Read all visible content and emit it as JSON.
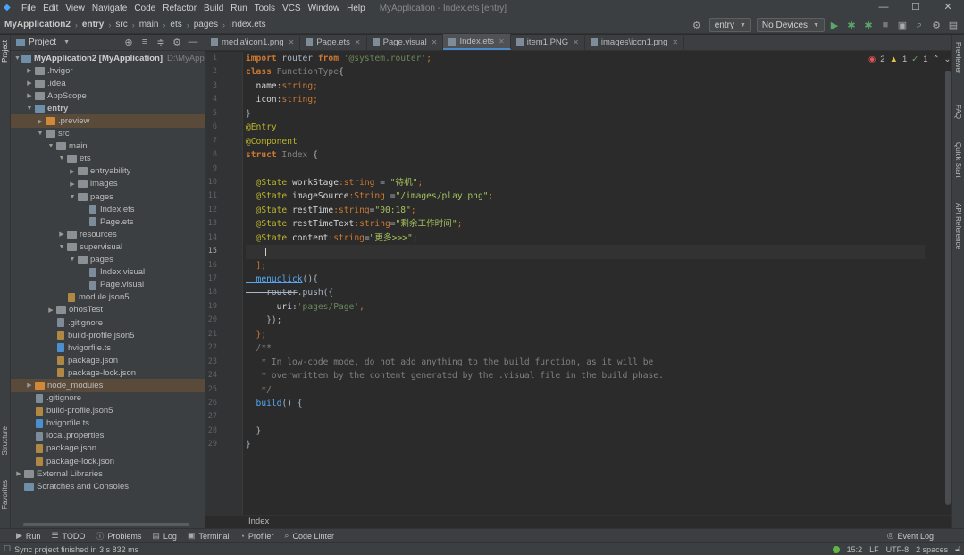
{
  "window": {
    "title": "MyApplication - Index.ets [entry]",
    "controls": [
      "—",
      "☐",
      "✕"
    ]
  },
  "menu": {
    "items": [
      "File",
      "Edit",
      "View",
      "Navigate",
      "Code",
      "Refactor",
      "Build",
      "Run",
      "Tools",
      "VCS",
      "Window",
      "Help"
    ]
  },
  "breadcrumb": {
    "items": [
      "MyApplication2",
      "entry",
      "src",
      "main",
      "ets",
      "pages",
      "Index.ets"
    ]
  },
  "toolbar": {
    "module_select": "entry",
    "device_select": "No Devices"
  },
  "project_panel": {
    "title": "Project",
    "tree": [
      {
        "label": "MyApplication2 [MyApplication]",
        "suffix": "D:\\MyAppli"
      },
      {
        "label": ".hvigor"
      },
      {
        "label": ".idea"
      },
      {
        "label": "AppScope"
      },
      {
        "label": "entry"
      },
      {
        "label": ".preview"
      },
      {
        "label": "src"
      },
      {
        "label": "main"
      },
      {
        "label": "ets"
      },
      {
        "label": "entryability"
      },
      {
        "label": "images"
      },
      {
        "label": "pages"
      },
      {
        "label": "Index.ets"
      },
      {
        "label": "Page.ets"
      },
      {
        "label": "resources"
      },
      {
        "label": "supervisual"
      },
      {
        "label": "pages"
      },
      {
        "label": "Index.visual"
      },
      {
        "label": "Page.visual"
      },
      {
        "label": "module.json5"
      },
      {
        "label": "ohosTest"
      },
      {
        "label": ".gitignore"
      },
      {
        "label": "build-profile.json5"
      },
      {
        "label": "hvigorfile.ts"
      },
      {
        "label": "package.json"
      },
      {
        "label": "package-lock.json"
      },
      {
        "label": "node_modules"
      },
      {
        "label": ".gitignore"
      },
      {
        "label": "build-profile.json5"
      },
      {
        "label": "hvigorfile.ts"
      },
      {
        "label": "local.properties"
      },
      {
        "label": "package.json"
      },
      {
        "label": "package-lock.json"
      },
      {
        "label": "External Libraries"
      },
      {
        "label": "Scratches and Consoles"
      }
    ]
  },
  "tabs": [
    {
      "label": "media\\icon1.png"
    },
    {
      "label": "Page.ets"
    },
    {
      "label": "Page.visual"
    },
    {
      "label": "Index.ets"
    },
    {
      "label": "item1.PNG"
    },
    {
      "label": "images\\icon1.png"
    }
  ],
  "inspections": {
    "errors": "2",
    "warnings": "1",
    "weak": "1"
  },
  "code": {
    "line_numbers": [
      "1",
      "2",
      "3",
      "4",
      "5",
      "6",
      "7",
      "8",
      "9",
      "10",
      "11",
      "12",
      "13",
      "14",
      "15",
      "16",
      "17",
      "18",
      "19",
      "20",
      "21",
      "22",
      "23",
      "24",
      "25",
      "26",
      "27",
      "28",
      "29"
    ],
    "l1": {
      "a": "import",
      "b": " router ",
      "c": "from",
      "d": " '@system.router'",
      "e": ";"
    },
    "l2": {
      "a": "class",
      "b": " FunctionType",
      "c": "{"
    },
    "l3": {
      "a": "  name",
      "b": ":",
      "c": "string",
      "d": ";"
    },
    "l4": {
      "a": "  icon",
      "b": ":",
      "c": "string",
      "d": ";"
    },
    "l5": "}",
    "l6": "@Entry",
    "l7": "@Component",
    "l8": {
      "a": "struct",
      "b": " Index",
      "c": " {"
    },
    "l10": {
      "a": "  @State",
      "b": " workStage",
      "c": ":string",
      "d": " = ",
      "e": "\"待机\"",
      "f": ";"
    },
    "l11": {
      "a": "  @State",
      "b": " imageSource",
      "c": ":String",
      "d": " =",
      "e": "\"/images/play.png\"",
      "f": ";"
    },
    "l12": {
      "a": "  @State",
      "b": " restTime",
      "c": ":string",
      "d": "=",
      "e": "\"00:18\"",
      "f": ";"
    },
    "l13": {
      "a": "  @State",
      "b": " restTimeText",
      "c": ":string",
      "d": "=",
      "e": "\"剩余工作时间\"",
      "f": ";"
    },
    "l14": {
      "a": "  @State",
      "b": " content",
      "c": ":string",
      "d": "=",
      "e": "\"更多>>>\"",
      "f": ";"
    },
    "l16": "  ];",
    "l17": {
      "a": "  menuclick",
      "b": "(){"
    },
    "l18": {
      "a": "    router",
      "b": ".push({"
    },
    "l19": {
      "a": "      uri",
      "b": ":",
      "c": "'pages/Page'",
      "d": ","
    },
    "l20": "    });",
    "l21": "  };",
    "l22": "  /**",
    "l23": "   * In low-code mode, do not add anything to the build function, as it will be",
    "l24": "   * overwritten by the content generated by the .visual file in the build phase.",
    "l25": "   */",
    "l26": {
      "a": "  build",
      "b": "() {"
    },
    "l28": "  }",
    "l29": "}"
  },
  "editor_breadcrumb": "Index",
  "side_labels": {
    "left_top": "Project",
    "left_structure": "Structure",
    "left_favorites": "Favorites",
    "right_previewer": "Previewer",
    "right_faq": "FAQ",
    "right_quick": "Quick Start",
    "right_api": "API Reference"
  },
  "bottom_tools": [
    "Run",
    "TODO",
    "Problems",
    "Log",
    "Terminal",
    "Profiler",
    "Code Linter"
  ],
  "event_log": "Event Log",
  "status": {
    "message": "Sync project finished in 3 s 832 ms",
    "position": "15:2",
    "line_sep": "LF",
    "encoding": "UTF-8",
    "indent": "2 spaces"
  },
  "colors": {
    "accent": "#4a88c7",
    "error": "#e05555",
    "warning": "#e6c243",
    "ok": "#62b543"
  }
}
